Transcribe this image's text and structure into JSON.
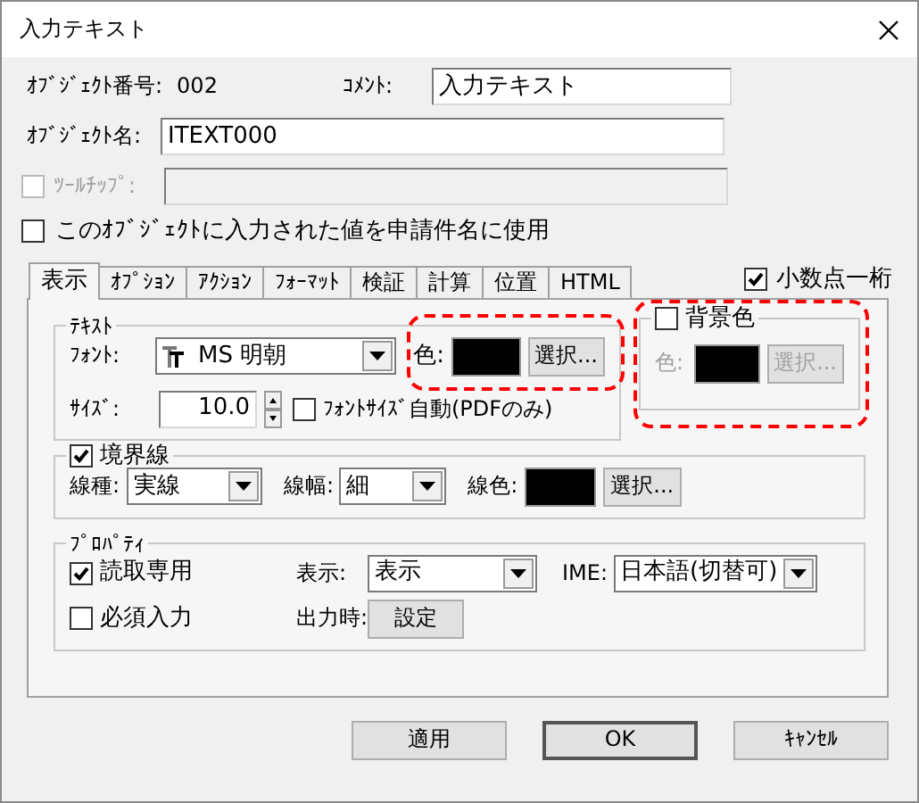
{
  "window": {
    "title": "入力テキスト"
  },
  "header": {
    "object_number_label": "ｵﾌﾞｼﾞｪｸﾄ番号:",
    "object_number": "002",
    "comment_label": "ｺﾒﾝﾄ:",
    "comment": "入力テキスト",
    "object_name_label": "ｵﾌﾞｼﾞｪｸﾄ名:",
    "object_name": "ITEXT000",
    "tooltip": {
      "label": "ﾂｰﾙﾁｯﾌﾟ:",
      "checked": false,
      "disabled": true
    },
    "use_as_subject": {
      "label": "このｵﾌﾞｼﾞｪｸﾄに入力された値を申請件名に使用",
      "checked": false
    }
  },
  "tabs": [
    {
      "label": "表示",
      "selected": true
    },
    {
      "label": "ｵﾌﾟｼｮﾝ",
      "selected": false
    },
    {
      "label": "ｱｸｼｮﾝ",
      "selected": false
    },
    {
      "label": "ﾌｫｰﾏｯﾄ",
      "selected": false
    },
    {
      "label": "検証",
      "selected": false
    },
    {
      "label": "計算",
      "selected": false
    },
    {
      "label": "位置",
      "selected": false
    },
    {
      "label": "HTML",
      "selected": false
    }
  ],
  "decimal": {
    "label": "小数点一桁",
    "checked": true
  },
  "text_group": {
    "title": "ﾃｷｽﾄ",
    "font_label": "ﾌｫﾝﾄ:",
    "font": "MS 明朝",
    "size_label": "ｻｲｽﾞ:",
    "size": "10.0",
    "auto_size": {
      "label": "ﾌｫﾝﾄｻｲｽﾞ自動(PDFのみ)",
      "checked": false
    },
    "color_label": "色:",
    "color": "#000000",
    "select_button": "選択..."
  },
  "background": {
    "label": "背景色",
    "checked": false,
    "disabled": true,
    "color_label": "色:",
    "color": "#000000",
    "select_button": "選択..."
  },
  "border": {
    "label": "境界線",
    "checked": true,
    "type_label": "線種:",
    "type": "実線",
    "width_label": "線幅:",
    "width": "細",
    "color_label": "線色:",
    "color": "#000000",
    "select_button": "選択..."
  },
  "properties": {
    "title": "ﾌﾟﾛﾊﾟﾃｨ",
    "read_only": {
      "label": "読取専用",
      "checked": true
    },
    "required": {
      "label": "必須入力",
      "checked": false
    },
    "display_label": "表示:",
    "display": "表示",
    "ime_label": "IME:",
    "ime": "日本語(切替可)",
    "output_label": "出力時:",
    "output_button": "設定"
  },
  "buttons": [
    {
      "label": "適用",
      "default": false
    },
    {
      "label": "OK",
      "default": true
    },
    {
      "label": "ｷｬﾝｾﾙ",
      "default": false
    }
  ],
  "annotations": [
    {
      "kind": "dashed-outline",
      "color": "#ff0000"
    },
    {
      "kind": "dashed-outline",
      "color": "#ff0000"
    }
  ]
}
